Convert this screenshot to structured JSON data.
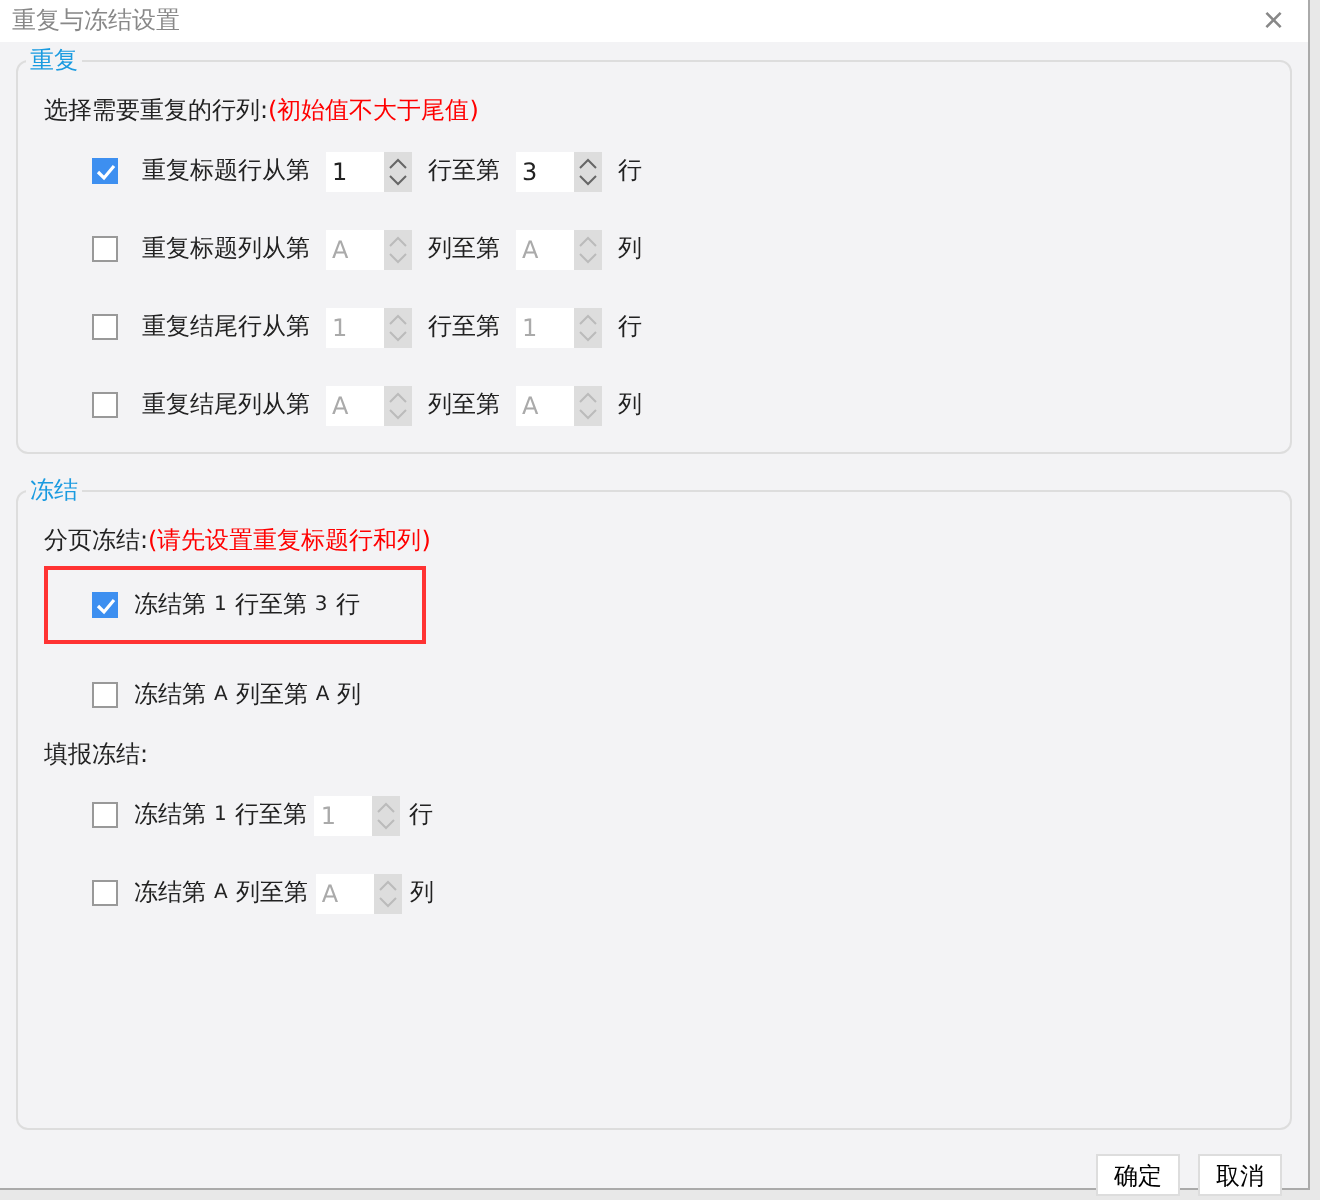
{
  "window": {
    "title": "重复与冻结设置",
    "close": "×"
  },
  "repeat": {
    "legend": "重复",
    "hint_label": "选择需要重复的行列:",
    "hint_note": "(初始值不大于尾值)",
    "rows": [
      {
        "checked": true,
        "label": "重复标题行从第",
        "from": {
          "value": "1",
          "disabled": false
        },
        "mid": "行至第",
        "to": {
          "value": "3",
          "disabled": false
        },
        "suffix": "行"
      },
      {
        "checked": false,
        "label": "重复标题列从第",
        "from": {
          "value": "A",
          "disabled": true
        },
        "mid": "列至第",
        "to": {
          "value": "A",
          "disabled": true
        },
        "suffix": "列"
      },
      {
        "checked": false,
        "label": "重复结尾行从第",
        "from": {
          "value": "1",
          "disabled": true
        },
        "mid": "行至第",
        "to": {
          "value": "1",
          "disabled": true
        },
        "suffix": "行"
      },
      {
        "checked": false,
        "label": "重复结尾列从第",
        "from": {
          "value": "A",
          "disabled": true
        },
        "mid": "列至第",
        "to": {
          "value": "A",
          "disabled": true
        },
        "suffix": "列"
      }
    ]
  },
  "freeze": {
    "legend": "冻结",
    "groups": [
      {
        "label": "分页冻结:",
        "note": "(请先设置重复标题行和列)",
        "rows": [
          {
            "checked": true,
            "highlighted": true,
            "label": "冻结第",
            "from": "1",
            "mid": "行至第",
            "to": {
              "kind": "text",
              "value": "3"
            },
            "suffix": "行"
          },
          {
            "checked": false,
            "highlighted": false,
            "label": "冻结第",
            "from": "A",
            "mid": "列至第",
            "to": {
              "kind": "text",
              "value": "A"
            },
            "suffix": "列"
          }
        ]
      },
      {
        "label": "填报冻结:",
        "rows": [
          {
            "checked": false,
            "highlighted": false,
            "label": "冻结第",
            "from": "1",
            "mid": "行至第",
            "to": {
              "kind": "spinner",
              "value": "1"
            },
            "suffix": "行"
          },
          {
            "checked": false,
            "highlighted": false,
            "label": "冻结第",
            "from": "A",
            "mid": "列至第",
            "to": {
              "kind": "spinner",
              "value": "A"
            },
            "suffix": "列"
          }
        ]
      }
    ]
  },
  "buttons": [
    "确定",
    "取消"
  ]
}
